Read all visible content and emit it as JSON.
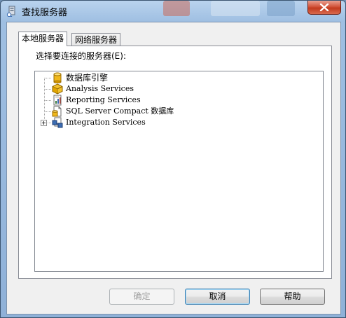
{
  "window": {
    "title": "查找服务器",
    "colors": {
      "titlebar": "#9fbfe2",
      "close": "#c23a1e",
      "client": "#f0f0f0"
    }
  },
  "tabs": [
    {
      "label": "本地服务器",
      "active": true
    },
    {
      "label": "网络服务器",
      "active": false
    }
  ],
  "panel": {
    "select_label": "选择要连接的服务器(E):"
  },
  "tree": {
    "items": [
      {
        "label": "数据库引擎",
        "icon": "database-engine-icon",
        "expandable": false
      },
      {
        "label": "Analysis Services",
        "icon": "analysis-services-icon",
        "expandable": false
      },
      {
        "label": "Reporting Services",
        "icon": "reporting-services-icon",
        "expandable": false
      },
      {
        "label": "SQL Server Compact 数据库",
        "icon": "sql-compact-icon",
        "expandable": false
      },
      {
        "label": "Integration Services",
        "icon": "integration-services-icon",
        "expandable": true
      }
    ]
  },
  "buttons": {
    "ok": "确定",
    "cancel": "取消",
    "help": "帮助"
  }
}
